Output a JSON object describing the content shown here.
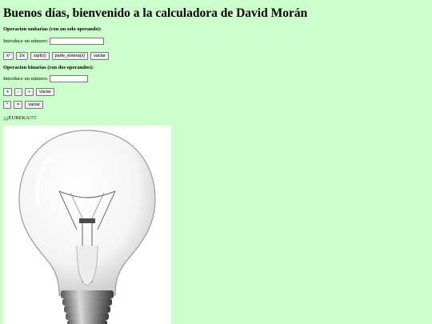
{
  "page": {
    "heading": "Buenos días, bienvenido a la calculadora de David Morán"
  },
  "unary": {
    "title": "Operacion unitarias (con un solo operando):",
    "input_label": "Introduce un número:",
    "input_value": "",
    "buttons": [
      "x²",
      "1/x",
      "sqrt(x)",
      "parte_entera(x)",
      "vaciar"
    ]
  },
  "binary": {
    "title": "Operacion binarias (con dos operandos):",
    "input_label": "Introduce un número:",
    "input_value": "",
    "buttons_row1": [
      "+",
      "-",
      "÷",
      "vaciar"
    ],
    "buttons_row2": [
      "*",
      "=",
      "vaciar"
    ]
  },
  "message": "¡¡¡EUREKA!!!!",
  "image": {
    "icon": "lightbulb-image"
  },
  "colors": {
    "background": "#ccffcc",
    "button_bg": "#efefef"
  }
}
